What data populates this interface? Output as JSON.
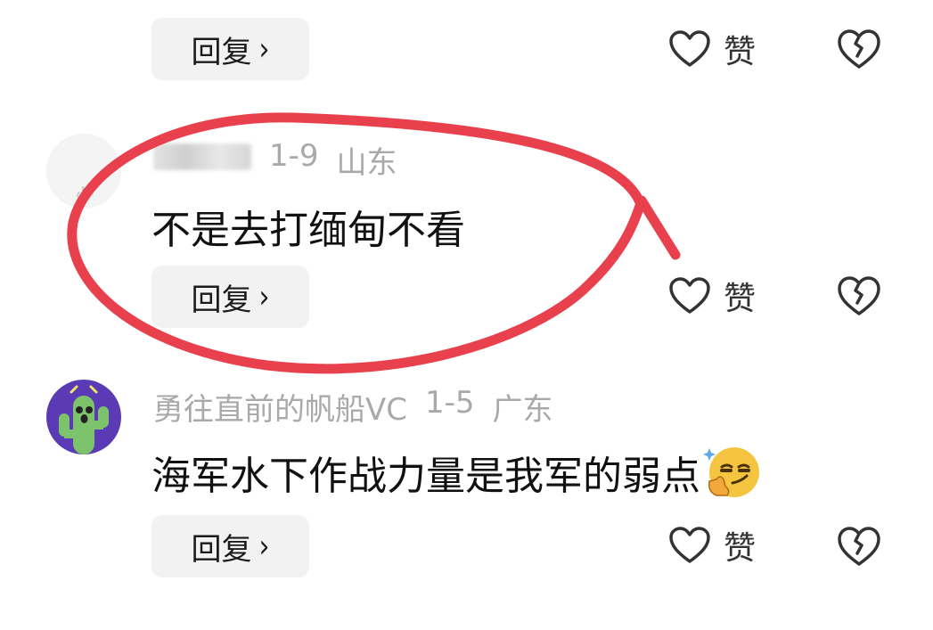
{
  "actions": {
    "reply_label": "回复",
    "like_label": "赞"
  },
  "comments": [
    {
      "meta_date": "1-9",
      "meta_region": "山东",
      "text": "不是去打缅甸不看"
    },
    {
      "username": "勇往直前的帆船VC",
      "meta_date": "1-5",
      "meta_region": "广东",
      "text": "海军水下作战力量是我军的弱点",
      "emoji": "smirk-thumb-emoji"
    }
  ],
  "colors": {
    "highlight_stroke": "#e8414d",
    "avatar_bg": "#5b3bb5",
    "cactus": "#7cc36b",
    "meta_text": "#a9a9a9"
  }
}
